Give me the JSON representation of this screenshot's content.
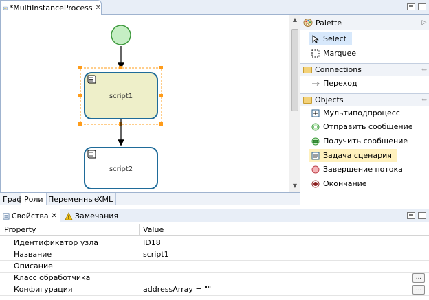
{
  "editor": {
    "tab_title": "*MultiInstanceProcess",
    "close_glyph": "✕"
  },
  "diagram": {
    "nodes": [
      {
        "id": "start",
        "kind": "start-event"
      },
      {
        "id": "script1",
        "kind": "script-task",
        "label": "script1",
        "selected": true,
        "fill": "#eeefc9"
      },
      {
        "id": "script2",
        "kind": "script-task",
        "label": "script2",
        "selected": false,
        "fill": "#ffffff"
      }
    ],
    "colors": {
      "task_border": "#1f6b99",
      "start_fill": "#c5eec4",
      "start_border": "#3f9a3e",
      "selection": "#ff9c1a"
    }
  },
  "palette": {
    "title": "Palette",
    "tools": [
      {
        "label": "Select",
        "icon": "arrow-pointer-icon",
        "selected": true
      },
      {
        "label": "Marquee",
        "icon": "marquee-icon",
        "selected": false
      }
    ],
    "connections": {
      "title": "Connections",
      "items": [
        {
          "label": "Переход",
          "icon": "transition-arrow-icon"
        }
      ]
    },
    "objects": {
      "title": "Objects",
      "items": [
        {
          "label": "Мультиподпроцесс",
          "icon": "multi-subprocess-icon",
          "highlight": false
        },
        {
          "label": "Отправить сообщение",
          "icon": "send-message-icon",
          "highlight": false
        },
        {
          "label": "Получить сообщение",
          "icon": "receive-message-icon",
          "highlight": false
        },
        {
          "label": "Задача сценария",
          "icon": "script-task-icon",
          "highlight": true
        },
        {
          "label": "Завершение потока",
          "icon": "end-flow-icon",
          "highlight": false
        },
        {
          "label": "Окончание",
          "icon": "end-event-icon",
          "highlight": false
        }
      ]
    }
  },
  "editor_pages": [
    {
      "label": "Граф",
      "active": false
    },
    {
      "label": "Роли",
      "active": true
    },
    {
      "label": "Переменные",
      "active": false
    },
    {
      "label": "XML",
      "active": false
    }
  ],
  "properties_view": {
    "tabs": [
      {
        "label": "Свойства",
        "icon": "properties-icon",
        "active": true
      },
      {
        "label": "Замечания",
        "icon": "warning-icon",
        "active": false
      }
    ],
    "columns": {
      "property": "Property",
      "value": "Value"
    },
    "rows": [
      {
        "name": "Идентификатор узла",
        "value": "ID18",
        "has_button": false
      },
      {
        "name": "Название",
        "value": "script1",
        "has_button": false
      },
      {
        "name": "Описание",
        "value": "",
        "has_button": false
      },
      {
        "name": "Класс обработчика",
        "value": "",
        "has_button": true
      },
      {
        "name": "Конфигурация",
        "value": "addressArray = \"\"",
        "has_button": true
      }
    ],
    "button_label": "..."
  }
}
